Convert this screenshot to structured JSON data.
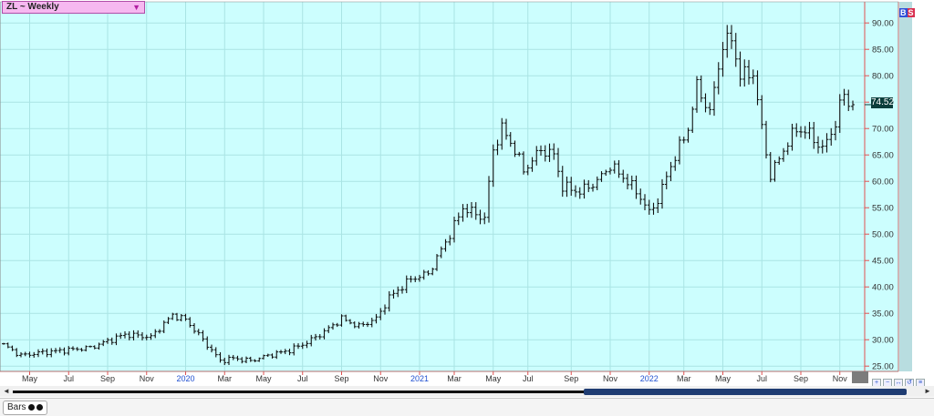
{
  "header": {
    "symbol_label": "ZL ~ Weekly",
    "dropdown_glyph": "▼"
  },
  "badges": {
    "buy": "B",
    "sell": "S"
  },
  "last_price": "74.52",
  "status_bar": {
    "tab_label": "Bars"
  },
  "colors": {
    "plot_bg": "#ccfefe",
    "grid": "#a9e4e4",
    "bar": "#111111",
    "accent_red": "#e05050",
    "price_label_bg": "#0b3d3b"
  },
  "icons": {
    "left_arrow": "left-arrow-icon",
    "right_arrow": "right-arrow-icon"
  },
  "chart_data": {
    "type": "ohlc",
    "title": "ZL ~ Weekly",
    "ylim": [
      24,
      94
    ],
    "y_ticks": [
      25,
      30,
      35,
      40,
      45,
      50,
      55,
      60,
      65,
      70,
      75,
      80,
      85,
      90
    ],
    "y_tick_labels": [
      "25.00",
      "30.00",
      "35.00",
      "40.00",
      "45.00",
      "50.00",
      "55.00",
      "60.00",
      "65.00",
      "70.00",
      "75.00",
      "80.00",
      "85.00",
      "90.00"
    ],
    "x_labels": [
      {
        "label": "May",
        "i": 6,
        "year": false
      },
      {
        "label": "Jul",
        "i": 15,
        "year": false
      },
      {
        "label": "Sep",
        "i": 24,
        "year": false
      },
      {
        "label": "Nov",
        "i": 33,
        "year": false
      },
      {
        "label": "2020",
        "i": 42,
        "year": true
      },
      {
        "label": "Mar",
        "i": 51,
        "year": false
      },
      {
        "label": "May",
        "i": 60,
        "year": false
      },
      {
        "label": "Jul",
        "i": 69,
        "year": false
      },
      {
        "label": "Sep",
        "i": 78,
        "year": false
      },
      {
        "label": "Nov",
        "i": 87,
        "year": false
      },
      {
        "label": "2021",
        "i": 96,
        "year": true
      },
      {
        "label": "Mar",
        "i": 104,
        "year": false
      },
      {
        "label": "May",
        "i": 113,
        "year": false
      },
      {
        "label": "Jul",
        "i": 121,
        "year": false
      },
      {
        "label": "Sep",
        "i": 131,
        "year": false
      },
      {
        "label": "Nov",
        "i": 140,
        "year": false
      },
      {
        "label": "2022",
        "i": 149,
        "year": true
      },
      {
        "label": "Mar",
        "i": 157,
        "year": false
      },
      {
        "label": "May",
        "i": 166,
        "year": false
      },
      {
        "label": "Jul",
        "i": 175,
        "year": false
      },
      {
        "label": "Sep",
        "i": 184,
        "year": false
      },
      {
        "label": "Nov",
        "i": 193,
        "year": false
      }
    ],
    "n_bars": 197,
    "anchors": [
      [
        0,
        29.0
      ],
      [
        4,
        27.0
      ],
      [
        8,
        27.5
      ],
      [
        14,
        28.0
      ],
      [
        20,
        28.5
      ],
      [
        28,
        31.0
      ],
      [
        34,
        30.5
      ],
      [
        39,
        34.7
      ],
      [
        42,
        33.8
      ],
      [
        46,
        30.0
      ],
      [
        50,
        26.0
      ],
      [
        53,
        26.5
      ],
      [
        57,
        26.0
      ],
      [
        61,
        27.0
      ],
      [
        66,
        28.0
      ],
      [
        70,
        29.5
      ],
      [
        74,
        31.5
      ],
      [
        78,
        34.0
      ],
      [
        82,
        32.5
      ],
      [
        86,
        34.0
      ],
      [
        89,
        38.0
      ],
      [
        94,
        41.5
      ],
      [
        98,
        42.5
      ],
      [
        103,
        50.0
      ],
      [
        106,
        55.0
      ],
      [
        111,
        53.0
      ],
      [
        113,
        66.0
      ],
      [
        115,
        70.0
      ],
      [
        118,
        66.0
      ],
      [
        120,
        62.0
      ],
      [
        124,
        66.0
      ],
      [
        127,
        65.0
      ],
      [
        129,
        59.0
      ],
      [
        133,
        58.0
      ],
      [
        137,
        60.0
      ],
      [
        140,
        63.0
      ],
      [
        144,
        60.0
      ],
      [
        147,
        57.0
      ],
      [
        149,
        54.0
      ],
      [
        151,
        56.5
      ],
      [
        154,
        63.0
      ],
      [
        158,
        70.0
      ],
      [
        160,
        78.0
      ],
      [
        163,
        73.0
      ],
      [
        166,
        86.0
      ],
      [
        168,
        87.0
      ],
      [
        170,
        80.0
      ],
      [
        173,
        80.5
      ],
      [
        175,
        70.0
      ],
      [
        177,
        61.0
      ],
      [
        180,
        66.0
      ],
      [
        183,
        70.0
      ],
      [
        186,
        69.0
      ],
      [
        189,
        66.0
      ],
      [
        192,
        71.0
      ],
      [
        194,
        77.0
      ],
      [
        195,
        74.5
      ],
      [
        196,
        74.52
      ]
    ]
  }
}
